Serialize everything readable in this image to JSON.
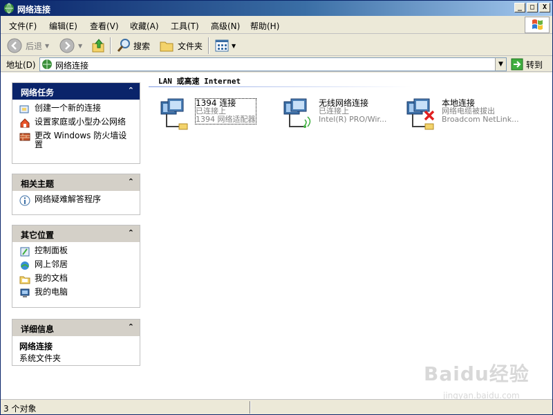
{
  "window": {
    "title": "网络连接",
    "controls": {
      "minimize": "_",
      "maximize": "□",
      "close": "X"
    }
  },
  "menu": {
    "items": [
      "文件(F)",
      "编辑(E)",
      "查看(V)",
      "收藏(A)",
      "工具(T)",
      "高级(N)",
      "帮助(H)"
    ]
  },
  "toolbar": {
    "back": "后退",
    "search": "搜索",
    "folders": "文件夹"
  },
  "address": {
    "label": "地址(D)",
    "value": "网络连接",
    "go": "转到"
  },
  "tasks": {
    "network": {
      "title": "网络任务",
      "items": [
        "创建一个新的连接",
        "设置家庭或小型办公网络",
        "更改 Windows 防火墙设置"
      ]
    },
    "related": {
      "title": "相关主题",
      "items": [
        "网络疑难解答程序"
      ]
    },
    "other": {
      "title": "其它位置",
      "items": [
        "控制面板",
        "网上邻居",
        "我的文档",
        "我的电脑"
      ]
    },
    "details": {
      "title": "详细信息",
      "name": "网络连接",
      "type": "系统文件夹"
    }
  },
  "group": {
    "header": "LAN 或高速 Internet"
  },
  "connections": [
    {
      "name": "1394 连接",
      "status": "已连接上",
      "device": "1394 网络适配器"
    },
    {
      "name": "无线网络连接",
      "status": "已连接上",
      "device": "Intel(R) PRO/Wir..."
    },
    {
      "name": "本地连接",
      "status": "网络电缆被拔出",
      "device": "Broadcom NetLink..."
    }
  ],
  "watermark": {
    "text": "Baidu经验",
    "sub": "jingyan.baidu.com"
  },
  "statusbar": {
    "text": "3 个对象"
  },
  "colors": {
    "title_blue": "#0a246a",
    "panel_grey": "#d4d0c8",
    "xp_face": "#ece9d8"
  }
}
